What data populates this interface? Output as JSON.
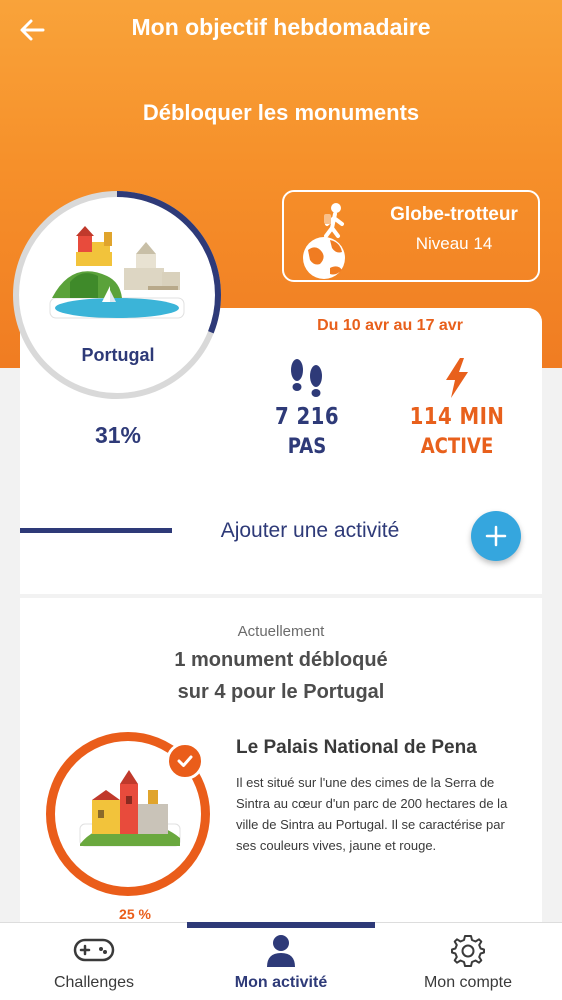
{
  "header": {
    "title": "Mon objectif hebdomadaire",
    "subtitle": "Débloquer les monuments",
    "back_icon": "arrow-left-icon"
  },
  "badge": {
    "title": "Globe-trotteur",
    "level": "Niveau 14",
    "icon": "hiker-globe-icon"
  },
  "country": {
    "name": "Portugal",
    "progress_label": "31%",
    "progress": 0.31
  },
  "period": {
    "label": "Du 10 avr au 17 avr"
  },
  "stats": {
    "steps": {
      "value": "7 216",
      "unit": "PAS",
      "icon": "footprints-icon"
    },
    "active": {
      "value": "114 MIN",
      "unit": "ACTIVE",
      "icon": "lightning-icon"
    }
  },
  "add_activity": {
    "label": "Ajouter une activité",
    "icon": "plus-icon"
  },
  "monuments": {
    "currently": "Actuellement",
    "unlocked_line1": "1 monument débloqué",
    "unlocked_line2": "sur 4 pour le Portugal",
    "current": {
      "title": "Le Palais National de Pena",
      "description": "Il est situé sur l'une des cimes de la Serra de Sintra au cœur d'un parc de 200 hectares de la ville de Sintra au Portugal. Il se caractérise par ses couleurs vives, jaune et rouge.",
      "progress_label": "25 %",
      "progress": 0.25
    }
  },
  "nav": {
    "items": [
      {
        "label": "Challenges",
        "icon": "gamepad-icon"
      },
      {
        "label": "Mon activité",
        "icon": "user-icon"
      },
      {
        "label": "Mon compte",
        "icon": "gear-icon"
      }
    ],
    "active_index": 1
  },
  "colors": {
    "orange": "#f6902a",
    "accent_orange": "#e8601c",
    "navy": "#2e3a78",
    "blue_button": "#35a6de"
  }
}
